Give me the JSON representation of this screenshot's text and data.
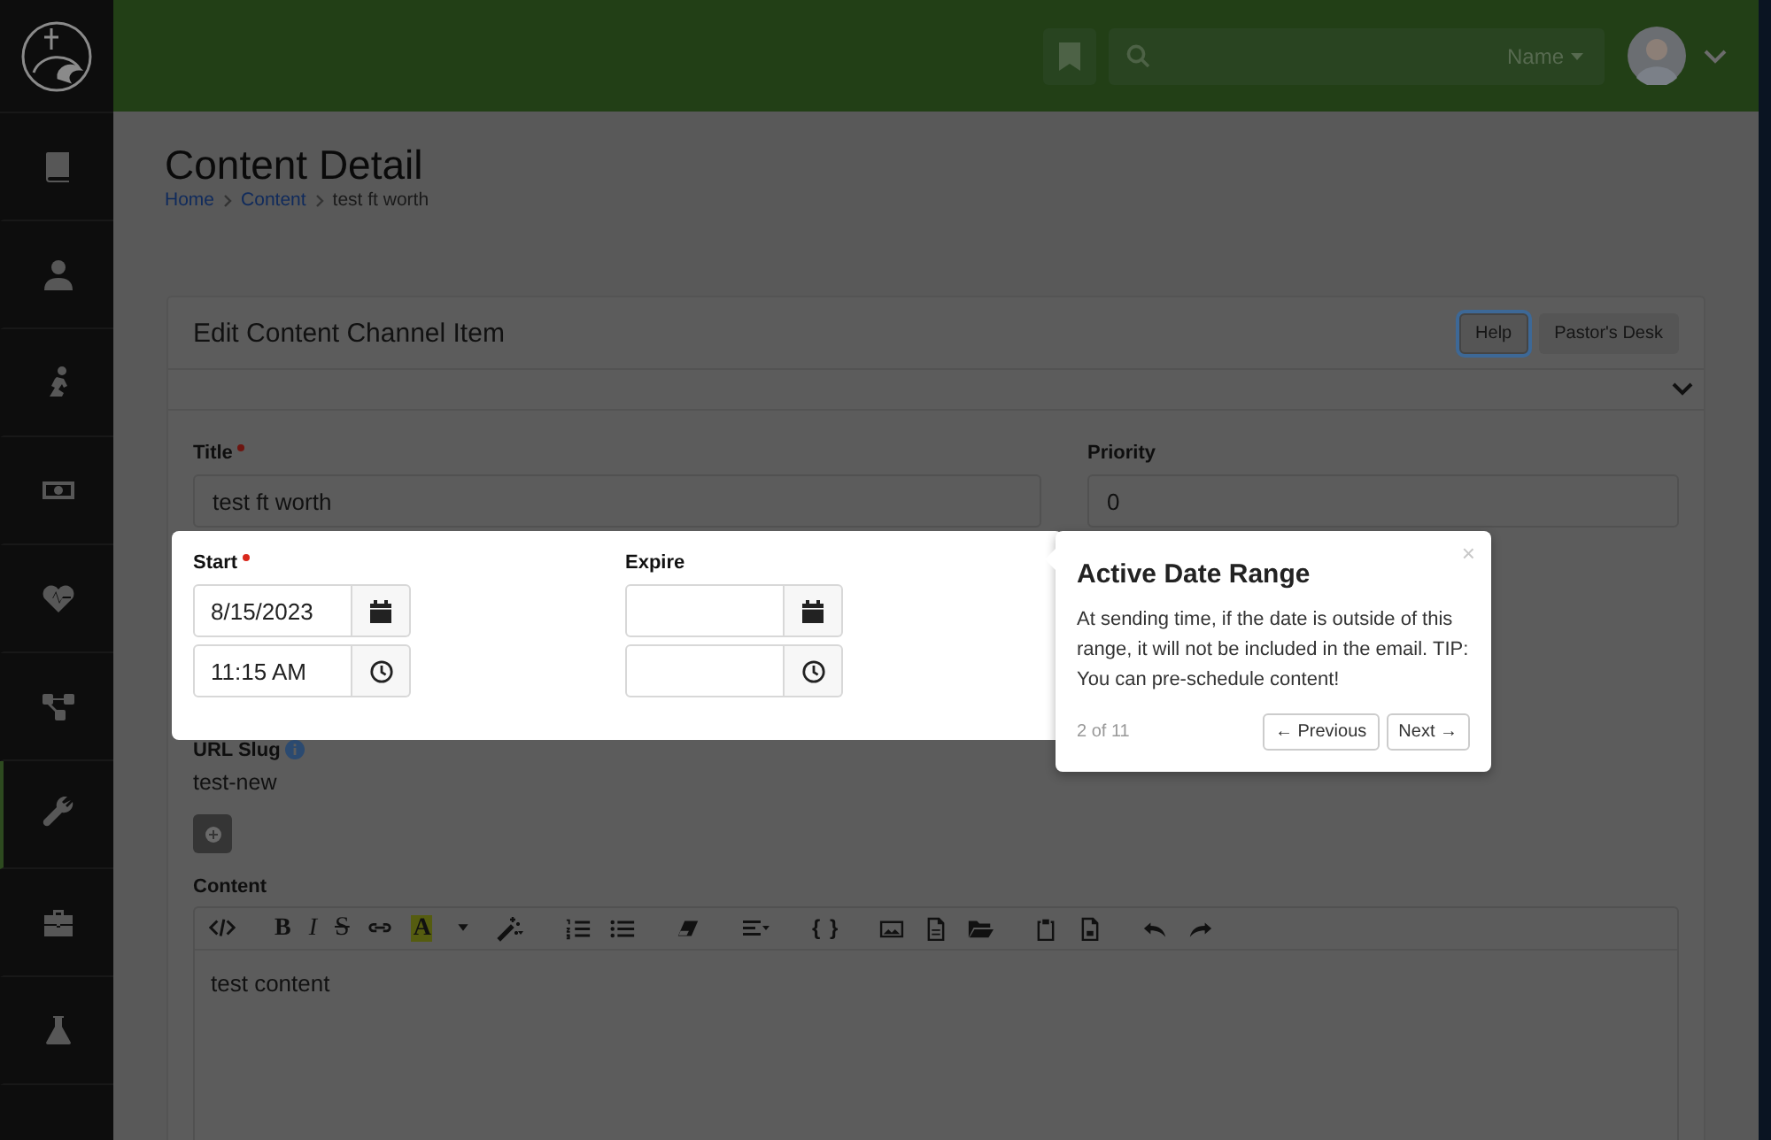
{
  "sidebar": {
    "items": [
      {
        "selected": false
      },
      {
        "selected": false
      },
      {
        "selected": false
      },
      {
        "selected": false
      },
      {
        "selected": false
      },
      {
        "selected": false
      },
      {
        "selected": true
      },
      {
        "selected": false
      },
      {
        "selected": false
      }
    ]
  },
  "topbar": {
    "search": {
      "filter": "Name"
    }
  },
  "page": {
    "title": "Content Detail",
    "breadcrumb": [
      {
        "label": "Home",
        "link": true
      },
      {
        "label": "Content",
        "link": true
      },
      {
        "label": "test ft worth",
        "link": false
      }
    ]
  },
  "card": {
    "title": "Edit Content Channel Item",
    "buttons": [
      {
        "label": "Help",
        "focused": true
      },
      {
        "label": "Pastor's Desk",
        "focused": false
      }
    ],
    "expanded": false
  },
  "form": {
    "title": {
      "label": "Title",
      "required": true,
      "value": "test ft worth"
    },
    "priority": {
      "label": "Priority",
      "required": false,
      "value": "0"
    },
    "start": {
      "label": "Start",
      "required": true,
      "date": "8/15/2023",
      "time": "11:15 AM"
    },
    "expire": {
      "label": "Expire",
      "required": false
    },
    "url_slug": {
      "label": "URL Slug",
      "value": "test-new"
    },
    "content": {
      "label": "Content",
      "value": "test content"
    },
    "toolbar": [
      {
        "kind": "code"
      },
      {
        "kind": "bold",
        "label": "B"
      },
      {
        "kind": "italic",
        "label": "I"
      },
      {
        "kind": "strike",
        "label": "S"
      },
      {
        "kind": "link"
      },
      {
        "kind": "color",
        "label": "A"
      },
      {
        "kind": "caret"
      },
      {
        "kind": "magic"
      },
      {
        "kind": "ol"
      },
      {
        "kind": "ul"
      },
      {
        "kind": "eraser"
      },
      {
        "kind": "align"
      },
      {
        "kind": "braces",
        "label": "{ }"
      },
      {
        "kind": "image"
      },
      {
        "kind": "file"
      },
      {
        "kind": "folder"
      },
      {
        "kind": "clipboard"
      },
      {
        "kind": "doc"
      },
      {
        "kind": "undo"
      },
      {
        "kind": "redo"
      }
    ]
  },
  "popover": {
    "title": "Active Date Range",
    "body": "At sending time, if the date is outside of this range, it will not be included in the email. TIP: You can pre-schedule content!",
    "step": "2 of 11",
    "buttons": [
      "← Previous",
      "Next →"
    ],
    "close": "×"
  }
}
